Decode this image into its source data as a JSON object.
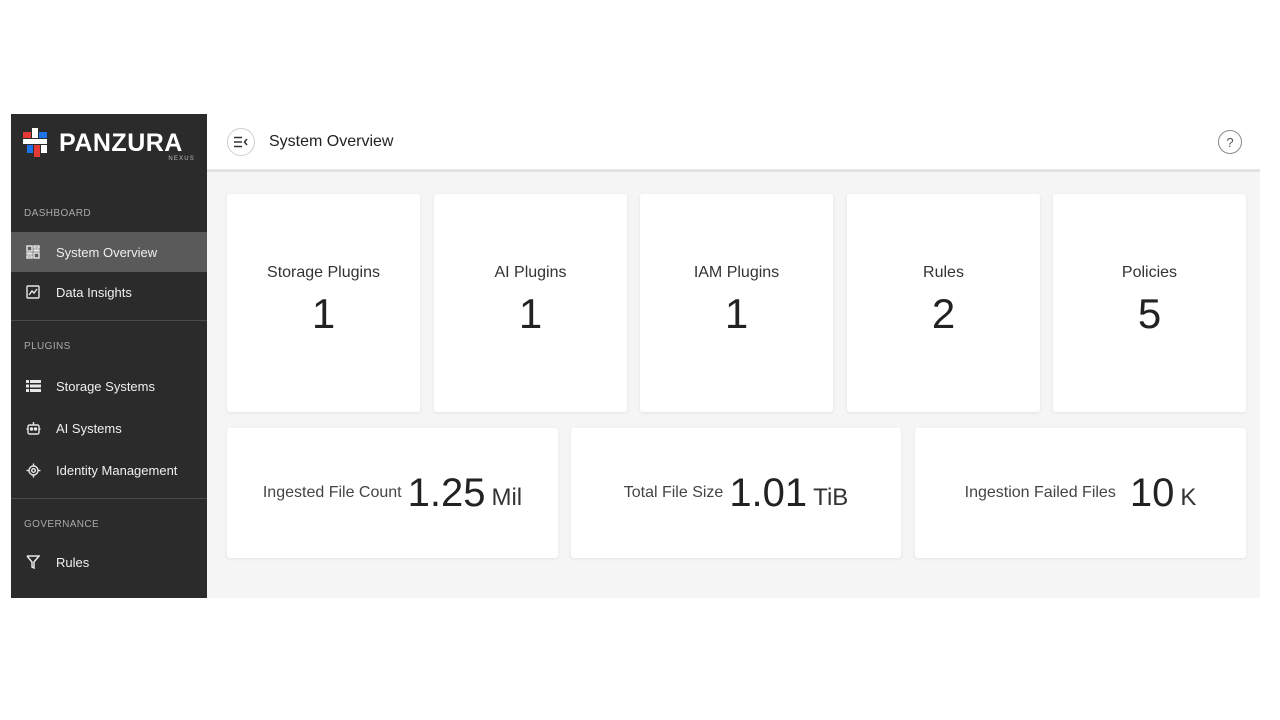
{
  "brand": {
    "name": "PANZURA",
    "sub": "NEXUS",
    "colors": {
      "red": "#e53935",
      "blue": "#1e73e8",
      "white": "#ffffff"
    }
  },
  "sidebar": {
    "sections": [
      {
        "label": "DASHBOARD",
        "items": [
          {
            "label": "System Overview",
            "icon": "grid-icon",
            "active": true
          },
          {
            "label": "Data Insights",
            "icon": "chart-icon",
            "active": false
          }
        ]
      },
      {
        "label": "PLUGINS",
        "items": [
          {
            "label": "Storage Systems",
            "icon": "list-icon",
            "active": false
          },
          {
            "label": "AI Systems",
            "icon": "robot-icon",
            "active": false
          },
          {
            "label": "Identity Management",
            "icon": "gear-icon",
            "active": false
          }
        ]
      },
      {
        "label": "GOVERNANCE",
        "items": [
          {
            "label": "Rules",
            "icon": "filter-icon",
            "active": false
          }
        ]
      }
    ]
  },
  "header": {
    "title": "System Overview",
    "help_icon": "help-icon",
    "toggle_icon": "menu-collapse-icon"
  },
  "stats": [
    {
      "label": "Storage Plugins",
      "value": "1"
    },
    {
      "label": "AI Plugins",
      "value": "1"
    },
    {
      "label": "IAM Plugins",
      "value": "1"
    },
    {
      "label": "Rules",
      "value": "2"
    },
    {
      "label": "Policies",
      "value": "5"
    }
  ],
  "metrics": [
    {
      "label": "Ingested File Count",
      "value": "1.25",
      "unit": "Mil"
    },
    {
      "label": "Total File Size",
      "value": "1.01",
      "unit": "TiB"
    },
    {
      "label": "Ingestion Failed Files",
      "value": "10",
      "unit": "K"
    }
  ]
}
